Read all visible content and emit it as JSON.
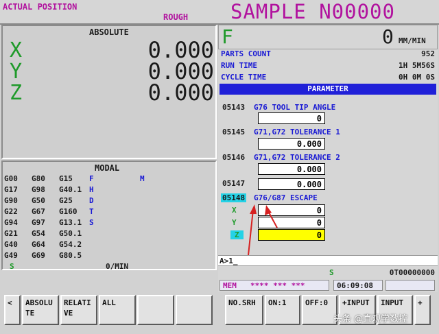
{
  "header": {
    "mode_title": "ACTUAL POSITION",
    "mode_sub": "ROUGH",
    "program": "SAMPLE N00000"
  },
  "position": {
    "title": "ABSOLUTE",
    "axes": [
      {
        "axis": "X",
        "value": "0.000"
      },
      {
        "axis": "Y",
        "value": "0.000"
      },
      {
        "axis": "Z",
        "value": "0.000"
      }
    ]
  },
  "modal": {
    "title": "MODAL",
    "rows": [
      [
        "G00",
        "G80",
        "G15",
        "F",
        "M"
      ],
      [
        "G17",
        "G98",
        "G40.1",
        "H",
        ""
      ],
      [
        "G90",
        "G50",
        "G25",
        "D",
        ""
      ],
      [
        "G22",
        "G67",
        "G160",
        "T",
        ""
      ],
      [
        "G94",
        "G97",
        "G13.1",
        "S",
        ""
      ],
      [
        "G21",
        "G54",
        "G50.1",
        "",
        ""
      ],
      [
        "G40",
        "G64",
        "G54.2",
        "",
        ""
      ],
      [
        "G49",
        "G69",
        "G80.5",
        "",
        ""
      ]
    ],
    "s_label": "S",
    "feed_unit": "0/MIN"
  },
  "feed": {
    "label": "F",
    "value": "0",
    "unit": "MM/MIN"
  },
  "status": {
    "parts_count_label": "PARTS COUNT",
    "parts_count_value": "952",
    "run_time_label": "RUN TIME",
    "run_time_value": "1H 5M56S",
    "cycle_time_label": "CYCLE TIME",
    "cycle_time_value": "0H 0M 0S"
  },
  "parameter": {
    "header": "PARAMETER",
    "entries": [
      {
        "num": "05143",
        "desc": "G76 TOOL TIP ANGLE",
        "value": "0"
      },
      {
        "num": "05145",
        "desc": "G71,G72 TOLERANCE 1",
        "value": "0.000"
      },
      {
        "num": "05146",
        "desc": "G71,G72 TOLERANCE 2",
        "value": "0.000"
      },
      {
        "num": "05147",
        "desc": "",
        "value": "0.000"
      }
    ],
    "escape": {
      "num": "05148",
      "desc": "G76/G87 ESCAPE",
      "axes": [
        {
          "axis": "X",
          "value": "0"
        },
        {
          "axis": "Y",
          "value": "0"
        },
        {
          "axis": "Z",
          "value": "0"
        }
      ]
    }
  },
  "input_line": "A>1_",
  "spindle": {
    "s_label": "S",
    "tool": "0T00000000"
  },
  "mem_bar": {
    "mode": "MEM",
    "stars": "**** *** ***",
    "clock": "06:09:08"
  },
  "softkeys_left": {
    "prev": "<",
    "keys": [
      "ABSOLU TE",
      "RELATI VE",
      "ALL",
      "",
      ""
    ]
  },
  "softkeys_right": {
    "keys": [
      "NO.SRH",
      "ON:1",
      "OFF:0",
      "+INPUT",
      "INPUT",
      "+"
    ]
  },
  "watermark": "头条 @直观学数控",
  "colors": {
    "magenta": "#b1129e",
    "blue": "#1a1ad4",
    "green": "#1f9a2a",
    "highlight_cyan": "#24d2e6",
    "highlight_yellow": "#ffff00",
    "arrow_red": "#d62020"
  }
}
